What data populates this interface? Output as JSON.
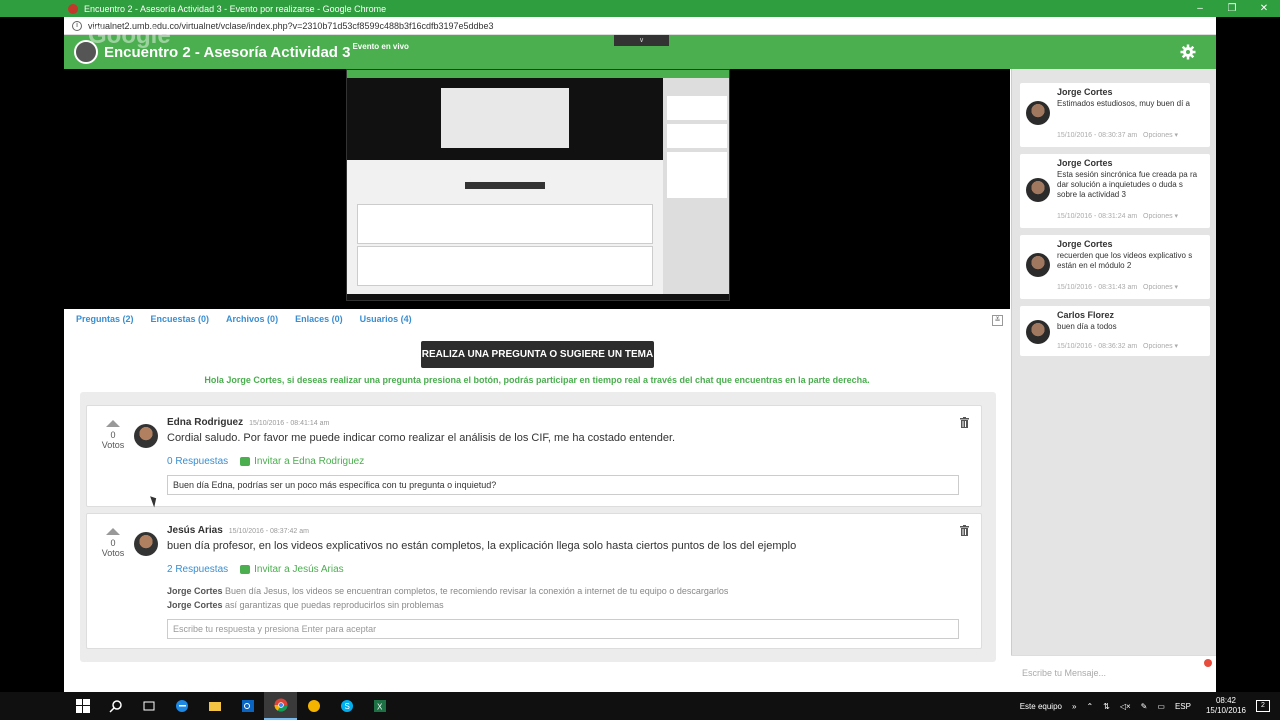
{
  "window": {
    "title": "Encuentro 2 - Asesoría Actividad 3 - Evento por realizarse - Google Chrome",
    "url": "virtualnet2.umb.edu.co/virtualnet/vclase/index.php?v=2310b71d53cf8599c488b3f16cdfb3197e5ddbe3",
    "minimize": "–",
    "maximize": "❐",
    "close": "✕"
  },
  "header": {
    "ghost": "Google",
    "title": "Encuentro 2 - Asesoría Actividad 3",
    "badge": "Evento en vivo",
    "dropdown": "∨"
  },
  "tabs": [
    {
      "label": "Preguntas (2)"
    },
    {
      "label": "Encuestas (0)"
    },
    {
      "label": "Archivos (0)"
    },
    {
      "label": "Enlaces (0)"
    },
    {
      "label": "Usuarios (4)"
    }
  ],
  "ask_button": "REALIZA UNA PREGUNTA O SUGIERE UN TEMA",
  "hello_text": "Hola Jorge Cortes, si deseas realizar una pregunta presiona el botón, podrás participar en tiempo real a través del chat que encuentras en la parte derecha.",
  "questions": [
    {
      "votes": "0",
      "votes_label": "Votos",
      "author": "Edna  Rodriguez",
      "date": "15/10/2016 - 08:41:14 am",
      "text": "Cordial saludo. Por favor me puede indicar como realizar el análisis de los CIF, me ha costado entender.",
      "responses": "0 Respuestas",
      "invite": "Invitar a Edna  Rodriguez",
      "answer_value": "Buen día Edna, podrías ser un poco más específica con tu pregunta o inquietud?"
    },
    {
      "votes": "0",
      "votes_label": "Votos",
      "author": "Jesús Arias",
      "date": "15/10/2016 - 08:37:42 am",
      "text": "buen día profesor, en los videos explicativos no están completos, la explicación llega solo hasta ciertos puntos de los del ejemplo",
      "responses": "2 Respuestas",
      "invite": "Invitar a Jesús Arias",
      "replies": [
        {
          "author": "Jorge Cortes",
          "text": "Buen día Jesus, los videos se encuentran completos, te recomiendo revisar la conexión a internet de tu equipo o descargarlos"
        },
        {
          "author": "Jorge Cortes",
          "text": "así garantizas que puedas reproducirlos sin problemas"
        }
      ],
      "answer_placeholder": "Escribe tu respuesta y presiona Enter para aceptar"
    }
  ],
  "chat": {
    "messages": [
      {
        "name": "Jorge Cortes",
        "text": "Estimados estudiosos, muy buen dí a",
        "time": "15/10/2016 - 08:30:37 am",
        "options": "Opciones ▾"
      },
      {
        "name": "Jorge Cortes",
        "text": "Esta sesión sincrónica fue creada pa ra dar solución a inquietudes o duda s sobre la actividad 3",
        "time": "15/10/2016 - 08:31:24 am",
        "options": "Opciones ▾"
      },
      {
        "name": "Jorge Cortes",
        "text": "recuerden que los videos explicativo s están en el módulo 2",
        "time": "15/10/2016 - 08:31:43 am",
        "options": "Opciones ▾"
      },
      {
        "name": "Carlos Florez",
        "text": "buen día a todos",
        "time": "15/10/2016 - 08:36:32 am",
        "options": "Opciones ▾"
      }
    ],
    "input_placeholder": "Escribe tu Mensaje..."
  },
  "taskbar": {
    "tray_label": "Este equipo",
    "chevron": "»",
    "lang": "ESP",
    "time": "08:42",
    "date": "15/10/2016",
    "notifications": "2"
  },
  "colors": {
    "brand_green": "#4bae4f",
    "link_blue": "#3a8ed0"
  }
}
